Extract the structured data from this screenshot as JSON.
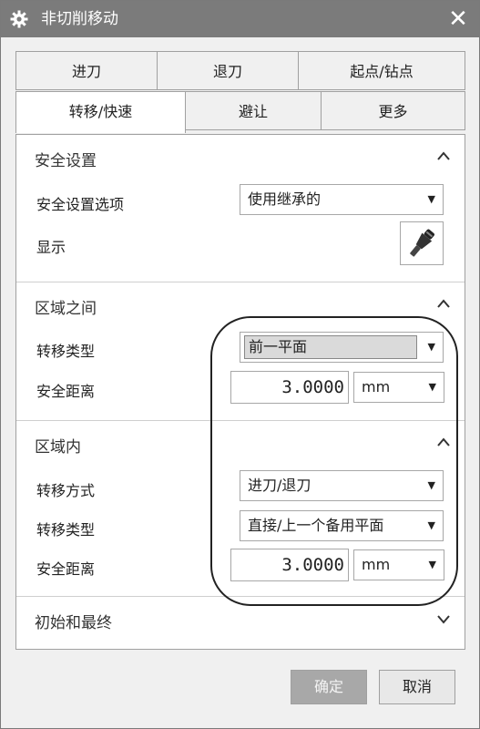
{
  "window": {
    "title": "非切削移动",
    "close_symbol": "✕"
  },
  "tabs": {
    "row1": [
      "进刀",
      "退刀",
      "起点/钻点"
    ],
    "row2": [
      "转移/快速",
      "避让",
      "更多"
    ],
    "active": "转移/快速"
  },
  "safety": {
    "header": "安全设置",
    "option_label": "安全设置选项",
    "option_value": "使用继承的",
    "display_label": "显示"
  },
  "between": {
    "header": "区域之间",
    "transfer_type_label": "转移类型",
    "transfer_type_value": "前一平面",
    "safe_distance_label": "安全距离",
    "safe_distance_value": "3.0000",
    "unit": "mm"
  },
  "within": {
    "header": "区域内",
    "transfer_method_label": "转移方式",
    "transfer_method_value": "进刀/退刀",
    "transfer_type_label": "转移类型",
    "transfer_type_value": "直接/上一个备用平面",
    "safe_distance_label": "安全距离",
    "safe_distance_value": "3.0000",
    "unit": "mm"
  },
  "initial_final": {
    "header": "初始和最终"
  },
  "buttons": {
    "ok": "确定",
    "cancel": "取消"
  },
  "icons": {
    "collapse": "chevron-up-icon",
    "expand": "chevron-down-icon",
    "dropdown": "caret-down-icon"
  }
}
